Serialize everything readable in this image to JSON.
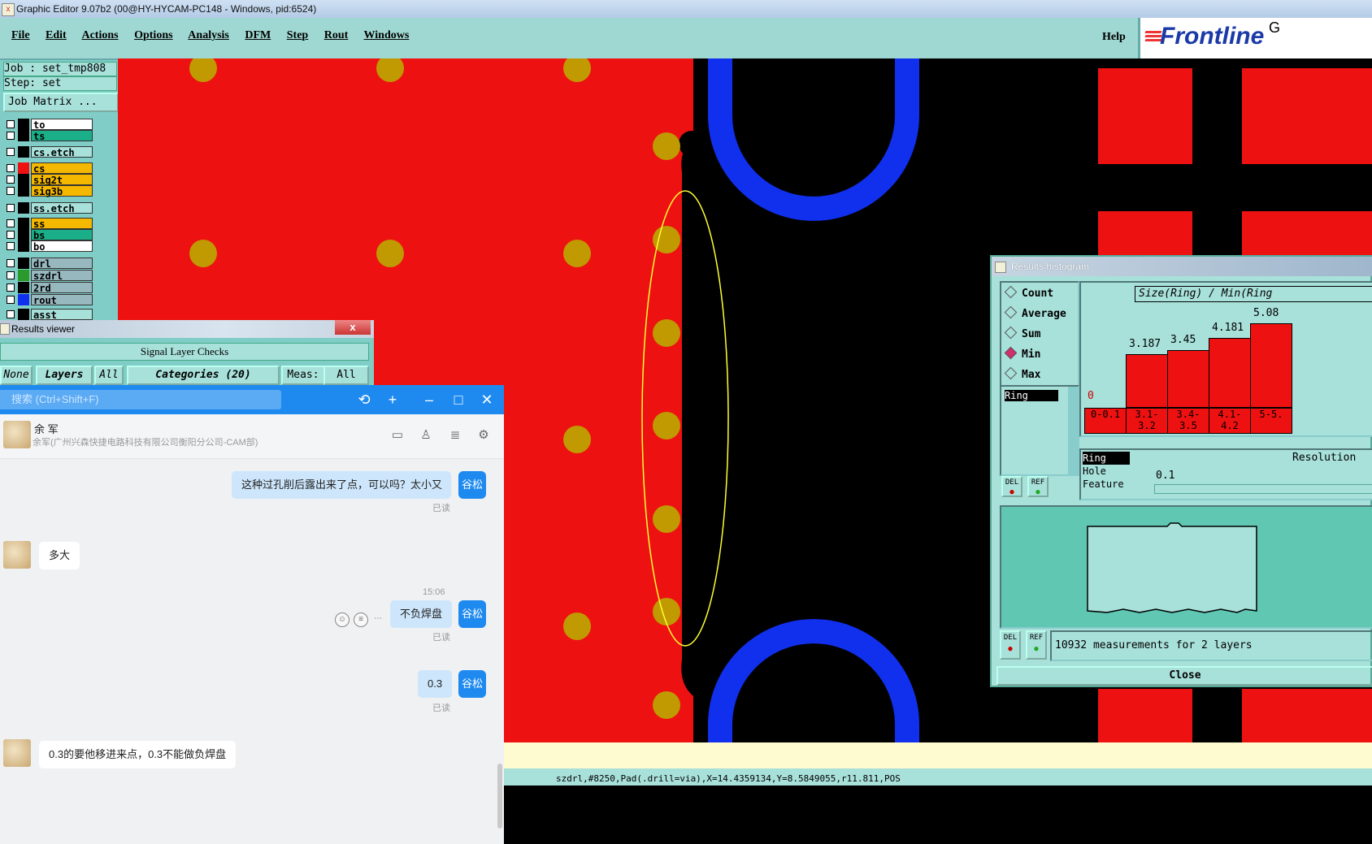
{
  "window": {
    "title": "Graphic Editor 9.07b2 (00@HY-HYCAM-PC148 - Windows, pid:6524)"
  },
  "menu": {
    "items": [
      "File",
      "Edit",
      "Actions",
      "Options",
      "Analysis",
      "DFM",
      "Step",
      "Rout",
      "Windows"
    ],
    "help": "Help",
    "logo": "Frontline",
    "logo_suffix": "G"
  },
  "job": {
    "job_label": "Job : set_tmp808",
    "step_label": "Step: set",
    "matrix_button": "Job Matrix ..."
  },
  "layers": [
    {
      "name": "to",
      "color": "#ffffff",
      "swatch": "#000000"
    },
    {
      "name": "ts",
      "color": "#1aaf88",
      "swatch": "#000000"
    },
    {
      "name": "cs.etch",
      "color": "#a8e0da",
      "swatch": "#000000"
    },
    {
      "name": "cs",
      "color": "#f5b800",
      "swatch": "#ee1111"
    },
    {
      "name": "sig2t",
      "color": "#f5b800",
      "swatch": "#000000"
    },
    {
      "name": "sig3b",
      "color": "#f5b800",
      "swatch": "#000000"
    },
    {
      "name": "ss.etch",
      "color": "#a8e0da",
      "swatch": "#000000"
    },
    {
      "name": "ss",
      "color": "#f5b800",
      "swatch": "#000000"
    },
    {
      "name": "bs",
      "color": "#1aaf88",
      "swatch": "#000000"
    },
    {
      "name": "bo",
      "color": "#ffffff",
      "swatch": "#000000"
    },
    {
      "name": "drl",
      "color": "#98b8c0",
      "swatch": "#000000"
    },
    {
      "name": "szdrl",
      "color": "#98b8c0",
      "swatch": "#2a9a2a"
    },
    {
      "name": "2rd",
      "color": "#98b8c0",
      "swatch": "#000000"
    },
    {
      "name": "rout",
      "color": "#98b8c0",
      "swatch": "#1030ee"
    },
    {
      "name": "asst",
      "color": "#a8e0da",
      "swatch": "#000000"
    }
  ],
  "results_viewer": {
    "title": "Results viewer",
    "close": "x",
    "section": "Signal Layer Checks",
    "buttons": {
      "none": "None",
      "layers": "Layers",
      "all": "All",
      "categories": "Categories (20)",
      "meas": "Meas:",
      "meas_value": "All"
    }
  },
  "chat": {
    "search_placeholder": "搜索 (Ctrl+Shift+F)",
    "contact_name": "余 军",
    "contact_sub": "余军(广州兴森快捷电路科技有限公司衡阳分公司-CAM部)",
    "my_tag": "谷松",
    "messages": [
      {
        "from": "me",
        "text": "这种过孔削后露出来了点，可以吗？太小又",
        "read": "已读"
      },
      {
        "from": "them",
        "text": "多大"
      },
      {
        "time": "15:06"
      },
      {
        "from": "me",
        "text": "不负焊盘",
        "read": "已读"
      },
      {
        "from": "me",
        "text": "0.3",
        "read": "已读"
      },
      {
        "from": "them",
        "text": "0.3的要他移进来点，0.3不能做负焊盘"
      }
    ]
  },
  "histogram": {
    "title": "Results histogram",
    "options": [
      "Count",
      "Average",
      "Sum",
      "Min",
      "Max"
    ],
    "selected": "Min",
    "plot_title": "Size(Ring) / Min(Ring",
    "list_selected": "Ring",
    "type_list": [
      "Ring",
      "Hole",
      "Feature"
    ],
    "resolution_label": "Resolution",
    "resolution_value": "0.1",
    "del": "DEL",
    "ref": "REF",
    "summary": "10932 measurements for 2 layers",
    "close": "Close",
    "chart_data": {
      "type": "bar",
      "categories": [
        "0-0.1",
        "3.1-3.2",
        "3.4-3.5",
        "4.1-4.2",
        "5-5."
      ],
      "values": [
        0,
        3.187,
        3.45,
        4.181,
        5.08
      ],
      "value_labels": [
        "0",
        "3.187",
        "3.45",
        "4.181",
        "5.08"
      ],
      "title": "Size(Ring) / Min(Ring"
    }
  },
  "status": {
    "coord": "szdrl,#8250,Pad(.drill=via),X=14.4359134,Y=8.5849055,r11.811,POS"
  },
  "colors": {
    "copper": "#ee1111",
    "pad": "#c09a00",
    "rout": "#1030ee",
    "panel": "#a8e0da",
    "chat_accent": "#1e8af0"
  }
}
